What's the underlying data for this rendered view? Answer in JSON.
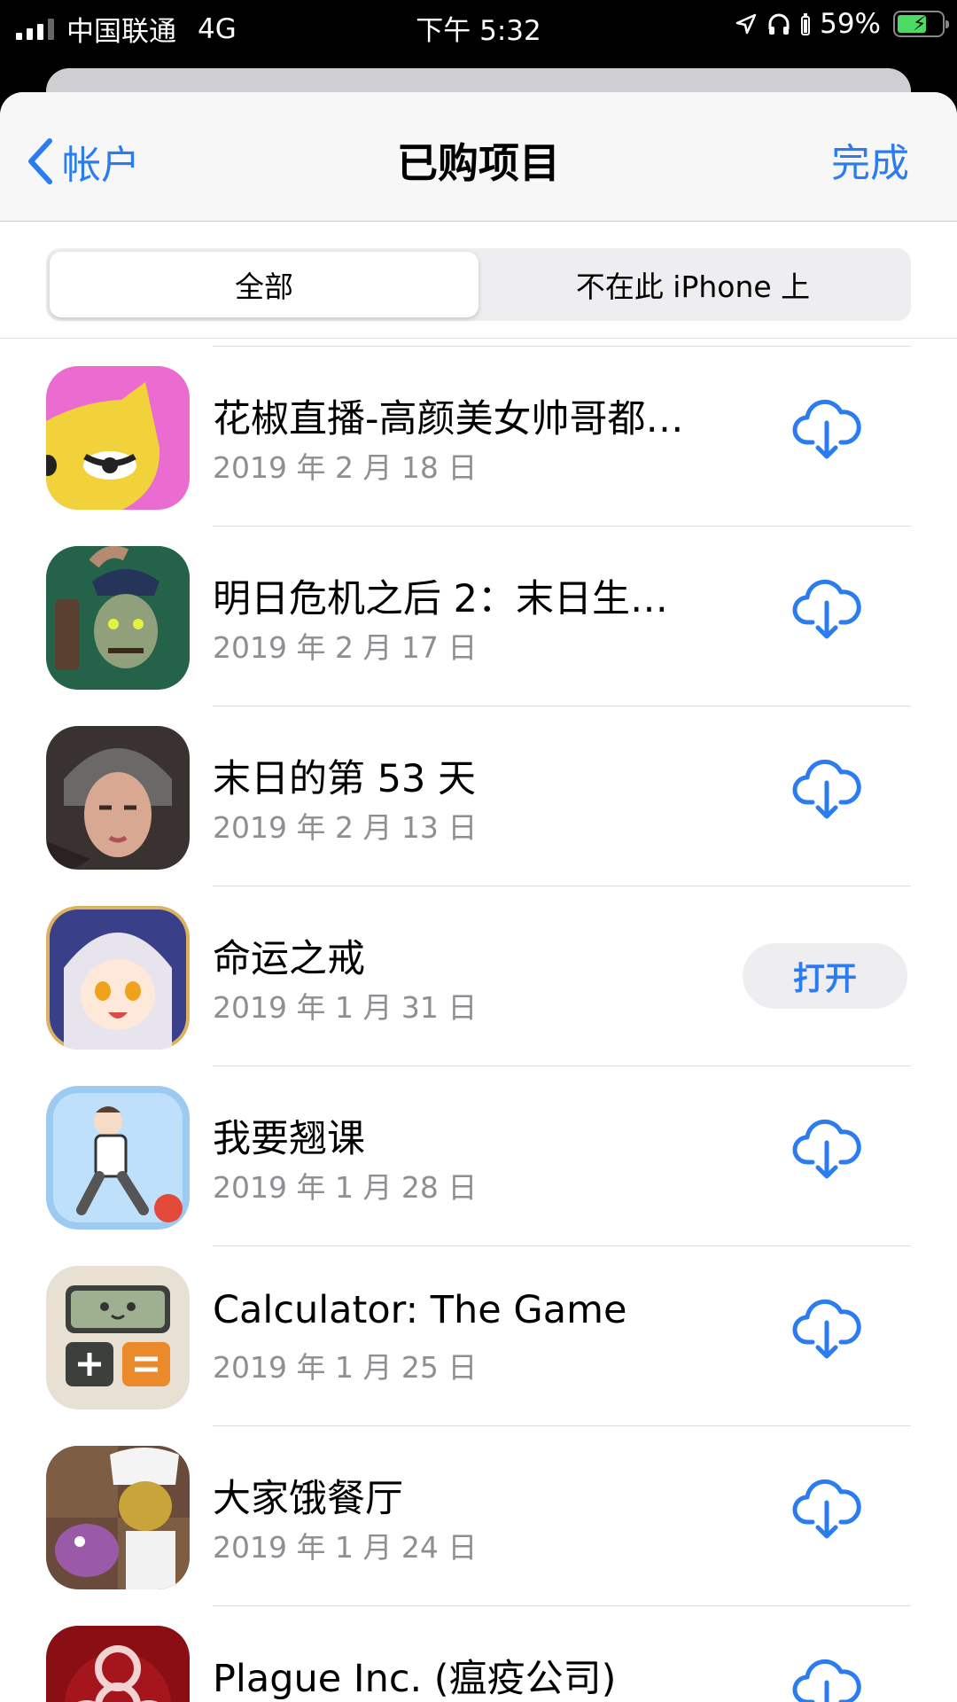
{
  "status_bar": {
    "carrier": "中国联通",
    "network": "4G",
    "time": "下午 5:32",
    "battery": "59%",
    "battery_level": 0.59
  },
  "nav": {
    "back_label": "帐户",
    "title": "已购项目",
    "done_label": "完成"
  },
  "segment": {
    "all_label": "全部",
    "not_on_device_label": "不在此 iPhone 上",
    "selected": "全部"
  },
  "apps": [
    {
      "name": "花椒直播-高颜美女帅哥都…",
      "date": "2019 年 2 月 18 日",
      "action": "download"
    },
    {
      "name": "明日危机之后 2：末日生…",
      "date": "2019 年 2 月 17 日",
      "action": "download"
    },
    {
      "name": "末日的第 53 天",
      "date": "2019 年 2 月 13 日",
      "action": "download"
    },
    {
      "name": "命运之戒",
      "date": "2019 年 1 月 31 日",
      "action": "open",
      "action_label": "打开"
    },
    {
      "name": "我要翘课",
      "date": "2019 年 1 月 28 日",
      "action": "download"
    },
    {
      "name": "Calculator: The Game",
      "date": "2019 年 1 月 25 日",
      "action": "download"
    },
    {
      "name": "大家饿餐厅",
      "date": "2019 年 1 月 24 日",
      "action": "download"
    },
    {
      "name": "Plague Inc. (瘟疫公司)",
      "date": "",
      "action": "download"
    }
  ],
  "colors": {
    "accent": "#2a7cf0",
    "secondary_text": "#8e8e93"
  }
}
